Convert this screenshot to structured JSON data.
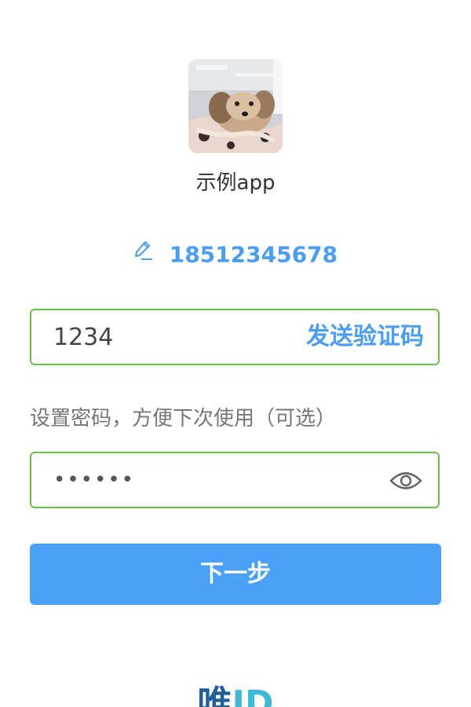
{
  "app": {
    "name": "示例app"
  },
  "phone": {
    "number": "18512345678",
    "edit_icon": "pencil-icon"
  },
  "verification": {
    "value": "1234",
    "send_label": "发送验证码"
  },
  "password": {
    "hint": "设置密码，方便下次使用（可选）",
    "value": "••••••",
    "toggle_icon": "eye-icon"
  },
  "next_button": {
    "label": "下一步"
  },
  "brand": {
    "part1": "唯",
    "part2": "ID"
  },
  "colors": {
    "accent": "#4a9df4",
    "field_border": "#6cc04a",
    "button_bg": "#4aa1f7"
  }
}
